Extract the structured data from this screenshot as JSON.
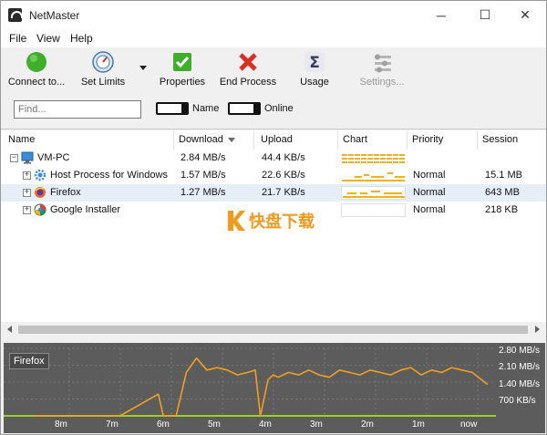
{
  "window": {
    "title": "NetMaster",
    "controls": {
      "minimize": "─",
      "maximize": "☐",
      "close": "✕"
    }
  },
  "menu": [
    "File",
    "View",
    "Help"
  ],
  "toolbar": {
    "connect": "Connect to...",
    "set_limits": "Set Limits",
    "properties": "Properties",
    "end_process": "End Process",
    "usage": "Usage",
    "settings": "Settings..."
  },
  "filter": {
    "find_placeholder": "Find...",
    "name_toggle": "Name",
    "online_toggle": "Online"
  },
  "columns": {
    "name": "Name",
    "download": "Download",
    "upload": "Upload",
    "chart": "Chart",
    "priority": "Priority",
    "session": "Session"
  },
  "rows": [
    {
      "name": "VM-PC",
      "download": "2.84 MB/s",
      "upload": "44.4 KB/s",
      "priority": "",
      "session": ""
    },
    {
      "name": "Host Process for Windows ...",
      "download": "1.57 MB/s",
      "upload": "22.6 KB/s",
      "priority": "Normal",
      "session": "15.1 MB"
    },
    {
      "name": "Firefox",
      "download": "1.27 MB/s",
      "upload": "21.7 KB/s",
      "priority": "Normal",
      "session": "643 MB"
    },
    {
      "name": "Google Installer",
      "download": "",
      "upload": "",
      "priority": "Normal",
      "session": "218 KB"
    }
  ],
  "watermark": {
    "brand": "快盘下载"
  },
  "graph": {
    "selected": "Firefox",
    "y_ticks": [
      "2.80 MB/s",
      "2.10 MB/s",
      "1.40 MB/s",
      "700 KB/s"
    ],
    "x_ticks": [
      "8m",
      "7m",
      "6m",
      "5m",
      "4m",
      "3m",
      "2m",
      "1m",
      "now"
    ],
    "line_color": "#f0a020",
    "baseline_color": "#9bd11c"
  },
  "chart_data": {
    "type": "line",
    "title": "",
    "xlabel": "",
    "ylabel": "",
    "ylim": [
      0,
      2.8
    ],
    "x_unit": "minutes ago",
    "x": [
      8.6,
      6.9,
      6.15,
      6.05,
      5.8,
      5.6,
      5.4,
      5.2,
      5.0,
      4.8,
      4.6,
      4.4,
      4.25,
      4.15,
      4.0,
      3.9,
      3.8,
      3.6,
      3.4,
      3.2,
      3.0,
      2.8,
      2.6,
      2.4,
      2.2,
      2.0,
      1.8,
      1.6,
      1.4,
      1.2,
      1.0,
      0.8,
      0.6,
      0.4,
      0.2,
      0.0,
      -0.3
    ],
    "series": [
      {
        "name": "Firefox",
        "values": [
          0.0,
          0.0,
          0.9,
          0.0,
          0.0,
          1.8,
          2.4,
          1.9,
          2.0,
          1.9,
          1.7,
          1.8,
          1.9,
          0.0,
          1.5,
          1.7,
          1.6,
          1.8,
          1.7,
          1.9,
          1.7,
          1.6,
          1.9,
          1.8,
          1.7,
          1.9,
          1.8,
          1.7,
          1.9,
          2.0,
          1.7,
          1.9,
          1.8,
          2.0,
          1.9,
          1.8,
          1.3
        ]
      }
    ]
  }
}
